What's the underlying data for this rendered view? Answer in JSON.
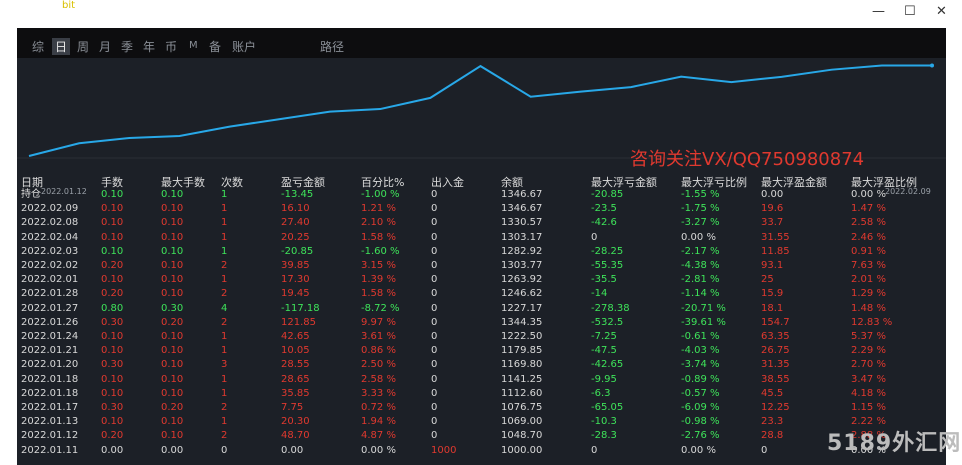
{
  "window": {
    "minimize": "—",
    "maximize": "☐",
    "close": "✕",
    "title_fragment": "bit"
  },
  "tabs": [
    "综",
    "日",
    "周",
    "月",
    "季",
    "年",
    "币",
    "M",
    "备",
    "账户",
    "路径"
  ],
  "active_tab": "日",
  "chart_data": {
    "type": "line",
    "x": [
      "2022.01.11",
      "2022.01.12",
      "2022.01.13",
      "2022.01.17",
      "2022.01.18",
      "2022.01.20",
      "2022.01.21",
      "2022.01.24",
      "2022.01.26",
      "2022.01.27",
      "2022.01.28",
      "2022.02.01",
      "2022.02.02",
      "2022.02.03",
      "2022.02.04",
      "2022.02.08",
      "2022.02.09"
    ],
    "series": [
      {
        "values": [
          1000.0,
          1048.7,
          1069.0,
          1076.75,
          1112.6,
          1141.25,
          1169.8,
          1179.85,
          1222.5,
          1344.35,
          1227.17,
          1246.62,
          1263.92,
          1303.77,
          1282.92,
          1303.17,
          1330.57,
          1346.67,
          1346.67
        ]
      }
    ],
    "x_start_label": "2022.01.12",
    "x_end_label": "2022.02.09",
    "line_color": "#28a8e8",
    "annotation": "咨询关注VX/QQ750980874",
    "annotation_color": "#e0392f",
    "ylim": [
      1000,
      1360
    ],
    "grid": false
  },
  "table": {
    "headers": [
      "日期",
      "手数",
      "最大手数",
      "次数",
      "盈亏金额",
      "百分比%",
      "出入金",
      "余额",
      "最大浮亏金额",
      "最大浮亏比例",
      "最大浮盈金额",
      "最大浮盈比例"
    ],
    "rows": [
      {
        "c": "green",
        "v": [
          "持仓",
          "0.10",
          "0.10",
          "1",
          "-13.45",
          "-1.00 %",
          "0",
          "1346.67",
          "-20.85",
          "-1.55 %",
          "0.00",
          "0.00 %"
        ]
      },
      {
        "c": "red",
        "v": [
          "2022.02.09",
          "0.10",
          "0.10",
          "1",
          "16.10",
          "1.21 %",
          "0",
          "1346.67",
          "-23.5",
          "-1.75 %",
          "19.6",
          "1.47 %"
        ]
      },
      {
        "c": "red",
        "v": [
          "2022.02.08",
          "0.10",
          "0.10",
          "1",
          "27.40",
          "2.10 %",
          "0",
          "1330.57",
          "-42.6",
          "-3.27 %",
          "33.7",
          "2.58 %"
        ]
      },
      {
        "c": "red",
        "v": [
          "2022.02.04",
          "0.10",
          "0.10",
          "1",
          "20.25",
          "1.58 %",
          "0",
          "1303.17",
          "0",
          "0.00 %",
          "31.55",
          "2.46 %"
        ]
      },
      {
        "c": "green",
        "v": [
          "2022.02.03",
          "0.10",
          "0.10",
          "1",
          "-20.85",
          "-1.60 %",
          "0",
          "1282.92",
          "-28.25",
          "-2.17 %",
          "11.85",
          "0.91 %"
        ]
      },
      {
        "c": "red",
        "v": [
          "2022.02.02",
          "0.20",
          "0.10",
          "2",
          "39.85",
          "3.15 %",
          "0",
          "1303.77",
          "-55.35",
          "-4.38 %",
          "93.1",
          "7.63 %"
        ]
      },
      {
        "c": "red",
        "v": [
          "2022.02.01",
          "0.10",
          "0.10",
          "1",
          "17.30",
          "1.39 %",
          "0",
          "1263.92",
          "-35.5",
          "-2.81 %",
          "25",
          "2.01 %"
        ]
      },
      {
        "c": "red",
        "v": [
          "2022.01.28",
          "0.20",
          "0.10",
          "2",
          "19.45",
          "1.58 %",
          "0",
          "1246.62",
          "-14",
          "-1.14 %",
          "15.9",
          "1.29 %"
        ]
      },
      {
        "c": "green",
        "v": [
          "2022.01.27",
          "0.80",
          "0.30",
          "4",
          "-117.18",
          "-8.72 %",
          "0",
          "1227.17",
          "-278.38",
          "-20.71 %",
          "18.1",
          "1.48 %"
        ]
      },
      {
        "c": "red",
        "v": [
          "2022.01.26",
          "0.30",
          "0.20",
          "2",
          "121.85",
          "9.97 %",
          "0",
          "1344.35",
          "-532.5",
          "-39.61 %",
          "154.7",
          "12.83 %"
        ]
      },
      {
        "c": "red",
        "v": [
          "2022.01.24",
          "0.10",
          "0.10",
          "1",
          "42.65",
          "3.61 %",
          "0",
          "1222.50",
          "-7.25",
          "-0.61 %",
          "63.35",
          "5.37 %"
        ]
      },
      {
        "c": "red",
        "v": [
          "2022.01.21",
          "0.10",
          "0.10",
          "1",
          "10.05",
          "0.86 %",
          "0",
          "1179.85",
          "-47.5",
          "-4.03 %",
          "26.75",
          "2.29 %"
        ]
      },
      {
        "c": "red",
        "v": [
          "2022.01.20",
          "0.30",
          "0.10",
          "3",
          "28.55",
          "2.50 %",
          "0",
          "1169.80",
          "-42.65",
          "-3.74 %",
          "31.35",
          "2.70 %"
        ]
      },
      {
        "c": "red",
        "v": [
          "2022.01.18",
          "0.10",
          "0.10",
          "1",
          "28.65",
          "2.58 %",
          "0",
          "1141.25",
          "-9.95",
          "-0.89 %",
          "38.55",
          "3.47 %"
        ]
      },
      {
        "c": "red",
        "v": [
          "2022.01.18",
          "0.10",
          "0.10",
          "1",
          "35.85",
          "3.33 %",
          "0",
          "1112.60",
          "-6.3",
          "-0.57 %",
          "45.5",
          "4.18 %"
        ]
      },
      {
        "c": "red",
        "v": [
          "2022.01.17",
          "0.30",
          "0.20",
          "2",
          "7.75",
          "0.72 %",
          "0",
          "1076.75",
          "-65.05",
          "-6.09 %",
          "12.25",
          "1.15 %"
        ]
      },
      {
        "c": "red",
        "v": [
          "2022.01.13",
          "0.10",
          "0.10",
          "1",
          "20.30",
          "1.94 %",
          "0",
          "1069.00",
          "-10.3",
          "-0.98 %",
          "23.3",
          "2.22 %"
        ]
      },
      {
        "c": "red",
        "v": [
          "2022.01.12",
          "0.20",
          "0.10",
          "2",
          "48.70",
          "4.87 %",
          "0",
          "1048.70",
          "-28.3",
          "-2.76 %",
          "28.8",
          "2.88 %"
        ]
      },
      {
        "c": "white",
        "v": [
          "2022.01.11",
          "0.00",
          "0.00",
          "0",
          "0.00",
          "0.00 %",
          "1000",
          "1000.00",
          "0",
          "0.00 %",
          "0",
          "0.00 %"
        ]
      }
    ]
  },
  "watermark": "5189外汇网"
}
